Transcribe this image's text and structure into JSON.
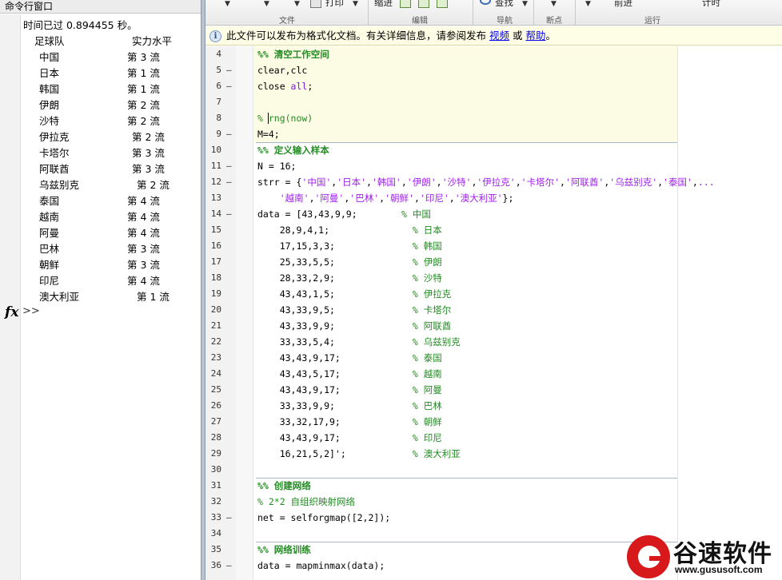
{
  "command_window": {
    "title": "命令行窗口",
    "elapsed": "时间已过 0.894455 秒。",
    "col_team": "足球队",
    "col_level": "实力水平",
    "rows": [
      {
        "team": "中国",
        "level": "第 3 流"
      },
      {
        "team": "日本",
        "level": "第 1 流"
      },
      {
        "team": "韩国",
        "level": "第 1 流"
      },
      {
        "team": "伊朗",
        "level": "第 2 流"
      },
      {
        "team": "沙特",
        "level": "第 2 流"
      },
      {
        "team": "伊拉克",
        "level": "第 2 流"
      },
      {
        "team": "卡塔尔",
        "level": "第 3 流"
      },
      {
        "team": "阿联酋",
        "level": "第 3 流"
      },
      {
        "team": "乌兹别克",
        "level": "第 2 流"
      },
      {
        "team": "泰国",
        "level": "第 4 流"
      },
      {
        "team": "越南",
        "level": "第 4 流"
      },
      {
        "team": "阿曼",
        "level": "第 4 流"
      },
      {
        "team": "巴林",
        "level": "第 3 流"
      },
      {
        "team": "朝鲜",
        "level": "第 3 流"
      },
      {
        "team": "印尼",
        "level": "第 4 流"
      },
      {
        "team": "澳大利亚",
        "level": "第 1 流"
      }
    ],
    "fx": "fx",
    "prompt": ">>"
  },
  "toolstrip": {
    "print": "打印",
    "indent": "缩进",
    "find": "查找",
    "forward": "前进",
    "timing": "计时",
    "sec_file": "文件",
    "sec_edit": "编辑",
    "sec_nav": "导航",
    "sec_break": "断点",
    "sec_run": "运行"
  },
  "infobar": {
    "text": "此文件可以发布为格式化文档。有关详细信息，请参阅发布",
    "video": "视频",
    "or": " 或 ",
    "help": "帮助",
    "end": "。"
  },
  "editor": {
    "lines": [
      {
        "n": "4",
        "m": "",
        "h": "<span class=\"cmh\">%% 清空工作空间</span>"
      },
      {
        "n": "5",
        "m": "–",
        "h": "clear,clc"
      },
      {
        "n": "6",
        "m": "–",
        "h": "close <span class=\"kw\">all</span>;"
      },
      {
        "n": "7",
        "m": "",
        "h": ""
      },
      {
        "n": "8",
        "m": "",
        "h": "<span class=\"cm\">% rng(now)</span>"
      },
      {
        "n": "9",
        "m": "–",
        "h": "M=4;"
      },
      {
        "n": "10",
        "m": "",
        "h": "<span class=\"cmh\">%% 定义输入样本</span>"
      },
      {
        "n": "11",
        "m": "–",
        "h": "N = 16;"
      },
      {
        "n": "12",
        "m": "–",
        "h": "strr = {<span class=\"st\">'中国'</span>,<span class=\"st\">'日本'</span>,<span class=\"st\">'韩国'</span>,<span class=\"st\">'伊朗'</span>,<span class=\"st\">'沙特'</span>,<span class=\"st\">'伊拉克'</span>,<span class=\"st\">'卡塔尔'</span>,<span class=\"st\">'阿联酋'</span>,<span class=\"st\">'乌兹别克'</span>,<span class=\"st\">'泰国'</span>,<span class=\"kw\">...</span>"
      },
      {
        "n": "13",
        "m": "",
        "h": "    <span class=\"st\">'越南'</span>,<span class=\"st\">'阿曼'</span>,<span class=\"st\">'巴林'</span>,<span class=\"st\">'朝鲜'</span>,<span class=\"st\">'印尼'</span>,<span class=\"st\">'澳大利亚'</span>};"
      },
      {
        "n": "14",
        "m": "–",
        "h": "data = [43,43,9,9;        <span class=\"cm\">% 中国</span>"
      },
      {
        "n": "15",
        "m": "",
        "h": "    28,9,4,1;               <span class=\"cm\">% 日本</span>"
      },
      {
        "n": "16",
        "m": "",
        "h": "    17,15,3,3;              <span class=\"cm\">% 韩国</span>"
      },
      {
        "n": "17",
        "m": "",
        "h": "    25,33,5,5;              <span class=\"cm\">% 伊朗</span>"
      },
      {
        "n": "18",
        "m": "",
        "h": "    28,33,2,9;              <span class=\"cm\">% 沙特</span>"
      },
      {
        "n": "19",
        "m": "",
        "h": "    43,43,1,5;              <span class=\"cm\">% 伊拉克</span>"
      },
      {
        "n": "20",
        "m": "",
        "h": "    43,33,9,5;              <span class=\"cm\">% 卡塔尔</span>"
      },
      {
        "n": "21",
        "m": "",
        "h": "    43,33,9,9;              <span class=\"cm\">% 阿联酋</span>"
      },
      {
        "n": "22",
        "m": "",
        "h": "    33,33,5,4;              <span class=\"cm\">% 乌兹别克</span>"
      },
      {
        "n": "23",
        "m": "",
        "h": "    43,43,9,17;             <span class=\"cm\">% 泰国</span>"
      },
      {
        "n": "24",
        "m": "",
        "h": "    43,43,5,17;             <span class=\"cm\">% 越南</span>"
      },
      {
        "n": "25",
        "m": "",
        "h": "    43,43,9,17;             <span class=\"cm\">% 阿曼</span>"
      },
      {
        "n": "26",
        "m": "",
        "h": "    33,33,9,9;              <span class=\"cm\">% 巴林</span>"
      },
      {
        "n": "27",
        "m": "",
        "h": "    33,32,17,9;             <span class=\"cm\">% 朝鲜</span>"
      },
      {
        "n": "28",
        "m": "",
        "h": "    43,43,9,17;             <span class=\"cm\">% 印尼</span>"
      },
      {
        "n": "29",
        "m": "",
        "h": "    16,21,5,2]';            <span class=\"cm\">% 澳大利亚</span>"
      },
      {
        "n": "30",
        "m": "",
        "h": ""
      },
      {
        "n": "31",
        "m": "",
        "h": "<span class=\"cmh\">%% 创建网络</span>"
      },
      {
        "n": "32",
        "m": "",
        "h": "<span class=\"cm\">% 2*2 自组织映射网络</span>"
      },
      {
        "n": "33",
        "m": "–",
        "h": "net = selforgmap([2,2]);"
      },
      {
        "n": "34",
        "m": "",
        "h": ""
      },
      {
        "n": "35",
        "m": "",
        "h": "<span class=\"cmh\">%% 网络训练</span>"
      },
      {
        "n": "36",
        "m": "–",
        "h": "data = mapminmax(data);"
      }
    ]
  },
  "watermark": {
    "name": "谷速软件",
    "url": "www.gususoft.com"
  }
}
